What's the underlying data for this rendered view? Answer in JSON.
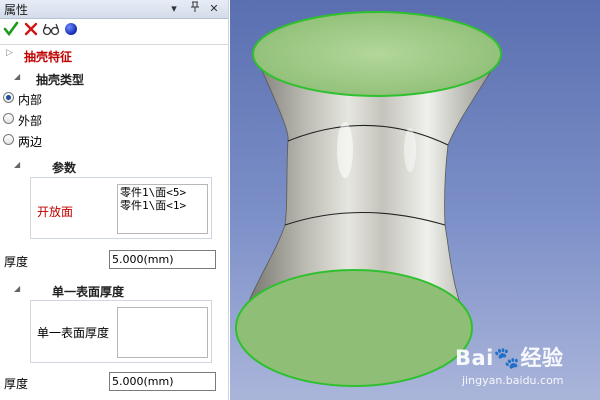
{
  "panel": {
    "title": "属性",
    "title_buttons": {
      "dropdown": "▾",
      "pin": "ᵖ",
      "close": "✕"
    },
    "toolbar": {
      "ok_icon": "check-icon",
      "cancel_icon": "x-icon",
      "preview_icon": "glasses-icon",
      "apply_icon": "blue-dot-icon"
    },
    "feature": {
      "label": "抽壳特征"
    },
    "shell_type": {
      "header": "抽壳类型",
      "options": [
        {
          "label": "内部",
          "selected": true
        },
        {
          "label": "外部",
          "selected": false
        },
        {
          "label": "两边",
          "selected": false
        }
      ]
    },
    "params": {
      "header": "参数",
      "open_face_label": "开放面",
      "open_faces": [
        "零件1\\面<5>",
        "零件1\\面<1>"
      ],
      "thickness_label": "厚度",
      "thickness_value": "5.000(mm)"
    },
    "single_surface": {
      "header": "单一表面厚度",
      "box_label": "单一表面厚度",
      "thickness_label": "厚度",
      "thickness_value": "5.000(mm)"
    }
  },
  "viewport": {
    "watermark_brand": "Bai🐾经验",
    "watermark_url": "jingyan.baidu.com"
  },
  "colors": {
    "open_face_label": "#c00000",
    "feature_label": "#c00000",
    "face_fill": "#8fbf77",
    "face_edge": "#2fc02f",
    "body_fill": "#a9a9a2",
    "background_top": "#5a6fb0"
  }
}
